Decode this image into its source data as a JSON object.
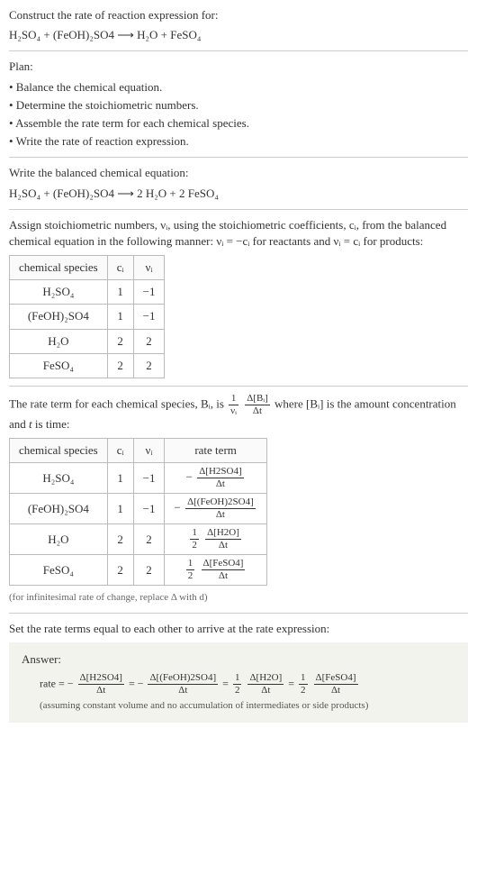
{
  "header": {
    "line1": "Construct the rate of reaction expression for:",
    "eq": "H₂SO₄ + (FeOH)₂SO4 ⟶ H₂O + FeSO₄"
  },
  "plan": {
    "title": "Plan:",
    "items": [
      "• Balance the chemical equation.",
      "• Determine the stoichiometric numbers.",
      "• Assemble the rate term for each chemical species.",
      "• Write the rate of reaction expression."
    ]
  },
  "balanced": {
    "line": "Write the balanced chemical equation:",
    "eq": "H₂SO₄ + (FeOH)₂SO4 ⟶ 2 H₂O + 2 FeSO₄"
  },
  "assign": {
    "text": "Assign stoichiometric numbers, νᵢ, using the stoichiometric coefficients, cᵢ, from the balanced chemical equation in the following manner: νᵢ = −cᵢ for reactants and νᵢ = cᵢ for products:"
  },
  "table1": {
    "headers": [
      "chemical species",
      "cᵢ",
      "νᵢ"
    ],
    "rows": [
      [
        "H₂SO₄",
        "1",
        "−1"
      ],
      [
        "(FeOH)₂SO4",
        "1",
        "−1"
      ],
      [
        "H₂O",
        "2",
        "2"
      ],
      [
        "FeSO₄",
        "2",
        "2"
      ]
    ]
  },
  "rateterm": {
    "pre": "The rate term for each chemical species, Bᵢ, is ",
    "frac1_num": "1",
    "frac1_den": "νᵢ",
    "frac2_num": "Δ[Bᵢ]",
    "frac2_den": "Δt",
    "mid": " where [Bᵢ] is the amount concentration and ",
    "tvar": "t",
    "post": " is time:"
  },
  "table2": {
    "headers": [
      "chemical species",
      "cᵢ",
      "νᵢ",
      "rate term"
    ],
    "rows": [
      {
        "species": "H₂SO₄",
        "c": "1",
        "v": "−1",
        "sign": "−",
        "coef": "",
        "num": "Δ[H2SO4]",
        "den": "Δt"
      },
      {
        "species": "(FeOH)₂SO4",
        "c": "1",
        "v": "−1",
        "sign": "−",
        "coef": "",
        "num": "Δ[(FeOH)2SO4]",
        "den": "Δt"
      },
      {
        "species": "H₂O",
        "c": "2",
        "v": "2",
        "sign": "",
        "coef_num": "1",
        "coef_den": "2",
        "num": "Δ[H2O]",
        "den": "Δt"
      },
      {
        "species": "FeSO₄",
        "c": "2",
        "v": "2",
        "sign": "",
        "coef_num": "1",
        "coef_den": "2",
        "num": "Δ[FeSO4]",
        "den": "Δt"
      }
    ]
  },
  "infinitesimal_note": "(for infinitesimal rate of change, replace Δ with d)",
  "setequal": "Set the rate terms equal to each other to arrive at the rate expression:",
  "answer": {
    "label": "Answer:",
    "prefix": "rate = −",
    "t1_num": "Δ[H2SO4]",
    "t1_den": "Δt",
    "eq1": " = −",
    "t2_num": "Δ[(FeOH)2SO4]",
    "t2_den": "Δt",
    "eq2": " = ",
    "c3_num": "1",
    "c3_den": "2",
    "t3_num": "Δ[H2O]",
    "t3_den": "Δt",
    "eq3": " = ",
    "c4_num": "1",
    "c4_den": "2",
    "t4_num": "Δ[FeSO4]",
    "t4_den": "Δt",
    "note": "(assuming constant volume and no accumulation of intermediates or side products)"
  }
}
